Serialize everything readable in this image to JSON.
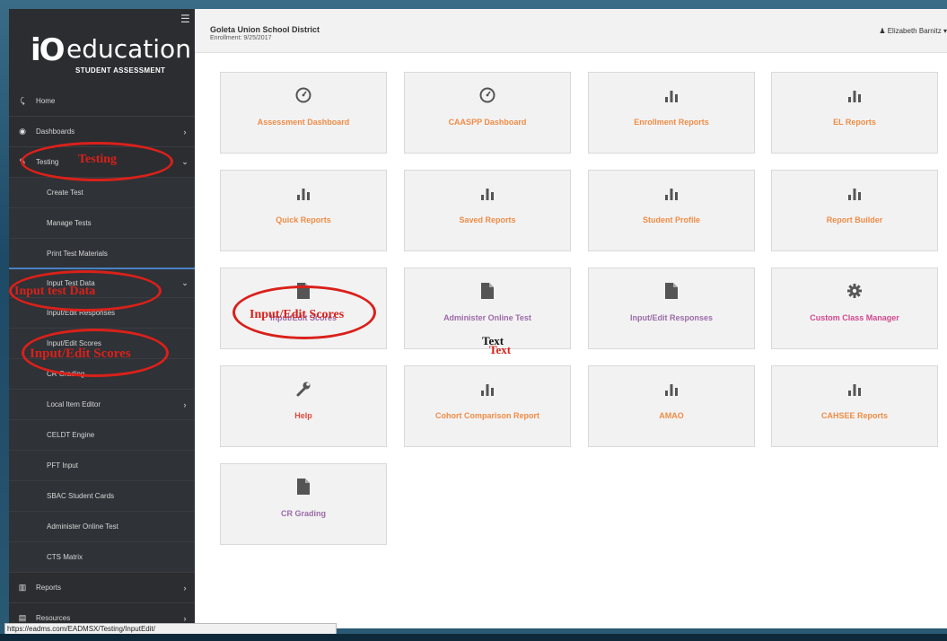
{
  "sidebar": {
    "logo_mark": "iO",
    "logo_text": "education",
    "logo_sub": "STUDENT ASSESSMENT",
    "menu_icon": "hamburger-icon",
    "items": [
      {
        "label": "Home",
        "icon": "home-icon"
      },
      {
        "label": "Dashboards",
        "icon": "dashboard-icon",
        "chevron": "›"
      },
      {
        "label": "Testing",
        "icon": "pencil-icon",
        "chevron": "⌄"
      },
      {
        "label": "Create Test"
      },
      {
        "label": "Manage Tests"
      },
      {
        "label": "Print Test Materials"
      },
      {
        "label": "Input Test Data",
        "chevron": "⌄"
      },
      {
        "label": "Input/Edit Responses"
      },
      {
        "label": "Input/Edit Scores"
      },
      {
        "label": "CR Grading"
      },
      {
        "label": "Local Item Editor",
        "chevron": "›"
      },
      {
        "label": "CELDT Engine"
      },
      {
        "label": "PFT Input"
      },
      {
        "label": "SBAC Student Cards"
      },
      {
        "label": "Administer Online Test"
      },
      {
        "label": "CTS Matrix"
      },
      {
        "label": "Reports",
        "icon": "bar-chart-icon",
        "chevron": "›"
      },
      {
        "label": "Resources",
        "icon": "book-icon",
        "chevron": "›"
      }
    ]
  },
  "header": {
    "district": "Goleta Union School District",
    "enrollment": "Enrollment: 9/25/2017",
    "user": "Elizabeth Barnitz ▾"
  },
  "tiles": [
    {
      "label": "Assessment Dashboard",
      "icon": "gauge-icon",
      "color": "#f08c46"
    },
    {
      "label": "CAASPP Dashboard",
      "icon": "gauge-icon",
      "color": "#f08c46"
    },
    {
      "label": "Enrollment Reports",
      "icon": "bar-chart-icon",
      "color": "#f08c46"
    },
    {
      "label": "EL Reports",
      "icon": "bar-chart-icon",
      "color": "#f08c46"
    },
    {
      "label": "Quick Reports",
      "icon": "bar-chart-icon",
      "color": "#f08c46"
    },
    {
      "label": "Saved Reports",
      "icon": "bar-chart-icon",
      "color": "#f08c46"
    },
    {
      "label": "Student Profile",
      "icon": "bar-chart-icon",
      "color": "#f08c46"
    },
    {
      "label": "Report Builder",
      "icon": "bar-chart-icon",
      "color": "#f08c46"
    },
    {
      "label": "Input/Edit Scores",
      "icon": "document-icon",
      "color": "#9c6ba8"
    },
    {
      "label": "Administer Online Test",
      "icon": "document-icon",
      "color": "#9c6ba8"
    },
    {
      "label": "Input/Edit Responses",
      "icon": "document-icon",
      "color": "#9c6ba8"
    },
    {
      "label": "Custom Class Manager",
      "icon": "gear-icon",
      "color": "#d2478f"
    },
    {
      "label": "Help",
      "icon": "wrench-icon",
      "color": "#e04a3c"
    },
    {
      "label": "Cohort Comparison Report",
      "icon": "bar-chart-icon",
      "color": "#f08c46"
    },
    {
      "label": "AMAO",
      "icon": "bar-chart-icon",
      "color": "#f08c46"
    },
    {
      "label": "CAHSEE Reports",
      "icon": "bar-chart-icon",
      "color": "#f08c46"
    },
    {
      "label": "CR Grading",
      "icon": "document-icon",
      "color": "#9c6ba8"
    }
  ],
  "annotations": {
    "testing": "Testing",
    "input_test_data": "Input test Data",
    "input_edit_scores_sidebar": "Input/Edit Scores",
    "input_edit_scores_tile": "Input/Edit Scores",
    "text_black": "Text",
    "text_red": "Text"
  },
  "statusbar": {
    "url": "https://eadms.com/EADMSX/Testing/InputEdit/"
  }
}
